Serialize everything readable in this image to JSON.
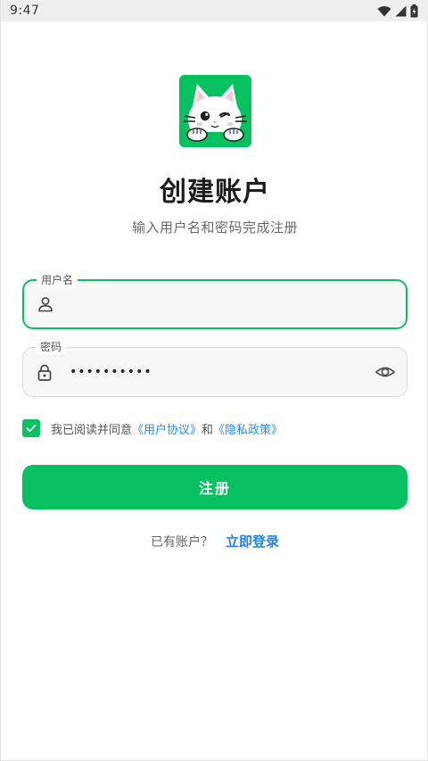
{
  "status_bar": {
    "time": "9:47",
    "icons": [
      "wifi-icon",
      "signal-icon",
      "battery-icon"
    ]
  },
  "logo": {
    "icon": "cat-mascot-icon",
    "color": "#07c160"
  },
  "header": {
    "title": "创建账户",
    "subtitle": "输入用户名和密码完成注册"
  },
  "form": {
    "username": {
      "label": "用户名",
      "value": "",
      "icon": "user-icon"
    },
    "password": {
      "label": "密码",
      "masked_value": "••••••••••",
      "icon": "lock-icon",
      "toggle_icon": "eye-icon"
    },
    "agreement": {
      "checked": true,
      "prefix": "我已阅读并同意",
      "terms_link": "《用户协议》",
      "and": "和",
      "privacy_link": "《隐私政策》"
    },
    "submit_label": "注册"
  },
  "footer": {
    "prompt": "已有账户？",
    "login_link": "立即登录"
  },
  "colors": {
    "accent": "#07c160",
    "link": "#2a8be6"
  }
}
